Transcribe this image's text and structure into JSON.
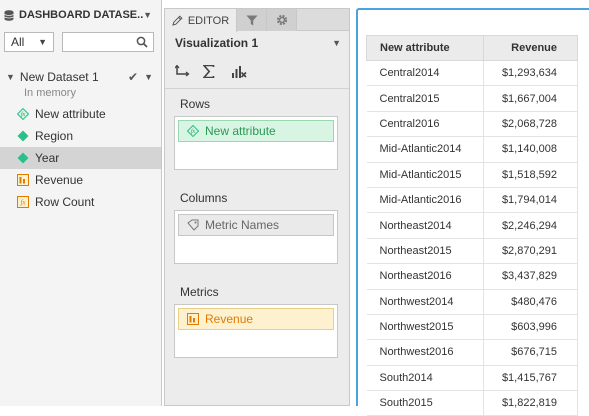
{
  "dataset_panel": {
    "title": "DASHBOARD DATASE...",
    "filter_value": "All",
    "search_placeholder": "",
    "dataset": {
      "name": "New Dataset 1",
      "subtitle": "In memory"
    },
    "fields": [
      {
        "label": "New attribute",
        "icon": "derived-attribute-icon",
        "color": "#2a9a55"
      },
      {
        "label": "Region",
        "icon": "attribute-icon",
        "color": "#2bbf8a"
      },
      {
        "label": "Year",
        "icon": "attribute-icon",
        "color": "#2bbf8a"
      },
      {
        "label": "Revenue",
        "icon": "metric-icon",
        "color": "#e07b00"
      },
      {
        "label": "Row Count",
        "icon": "derived-metric-icon",
        "color": "#e07b00"
      }
    ]
  },
  "editor_panel": {
    "tab_editor": "EDITOR",
    "visualization_title": "Visualization 1",
    "rows_label": "Rows",
    "rows_item": "New attribute",
    "columns_label": "Columns",
    "columns_item": "Metric Names",
    "metrics_label": "Metrics",
    "metrics_item": "Revenue"
  },
  "grid": {
    "columns": [
      "New attribute",
      "Revenue"
    ],
    "rows": [
      [
        "Central2014",
        "$1,293,634"
      ],
      [
        "Central2015",
        "$1,667,004"
      ],
      [
        "Central2016",
        "$2,068,728"
      ],
      [
        "Mid-Atlantic2014",
        "$1,140,008"
      ],
      [
        "Mid-Atlantic2015",
        "$1,518,592"
      ],
      [
        "Mid-Atlantic2016",
        "$1,794,014"
      ],
      [
        "Northeast2014",
        "$2,246,294"
      ],
      [
        "Northeast2015",
        "$2,870,291"
      ],
      [
        "Northeast2016",
        "$3,437,829"
      ],
      [
        "Northwest2014",
        "$480,476"
      ],
      [
        "Northwest2015",
        "$603,996"
      ],
      [
        "Northwest2016",
        "$676,715"
      ],
      [
        "South2014",
        "$1,415,767"
      ],
      [
        "South2015",
        "$1,822,819"
      ]
    ]
  },
  "colors": {
    "accent": "#4aa3df",
    "attribute": "#2bbf8a",
    "metric": "#e07b00"
  }
}
